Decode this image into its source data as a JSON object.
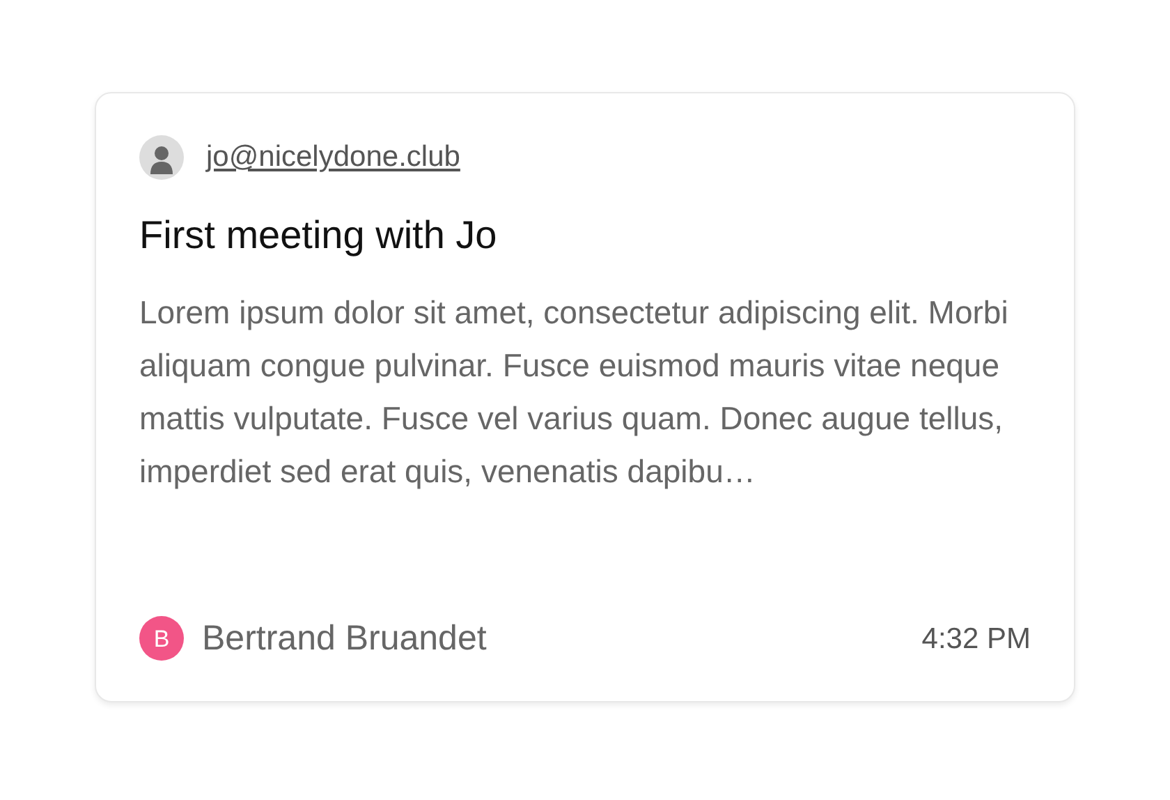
{
  "card": {
    "email": "jo@nicelydone.club",
    "title": "First meeting with Jo",
    "body": "Lorem ipsum dolor sit amet, consectetur adipiscing elit. Morbi aliquam congue pulvinar. Fusce euismod mauris vitae neque mattis vulputate. Fusce vel varius quam. Donec augue tellus, imperdiet sed erat quis, venenatis dapibu…",
    "author": {
      "initial": "B",
      "name": "Bertrand Bruandet"
    },
    "time": "4:32 PM"
  }
}
